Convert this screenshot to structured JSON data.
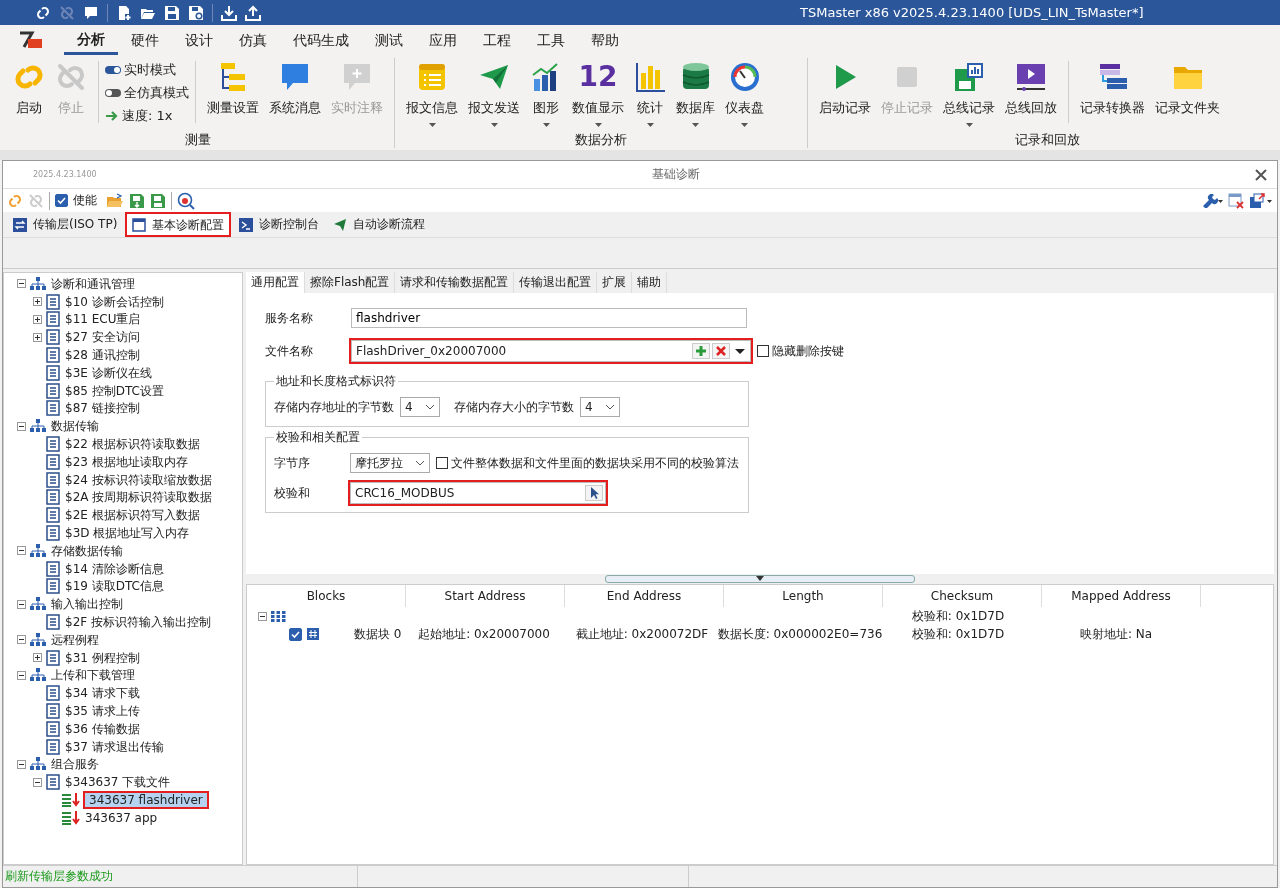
{
  "window": {
    "title": "TSMaster x86 v2025.4.23.1400 [UDS_LIN_TsMaster*]"
  },
  "menu": [
    {
      "label": "分析",
      "selected": true
    },
    {
      "label": "硬件",
      "selected": false
    },
    {
      "label": "设计",
      "selected": false
    },
    {
      "label": "仿真",
      "selected": false
    },
    {
      "label": "代码生成",
      "selected": false
    },
    {
      "label": "测试",
      "selected": false
    },
    {
      "label": "应用",
      "selected": false
    },
    {
      "label": "工程",
      "selected": false
    },
    {
      "label": "工具",
      "selected": false
    },
    {
      "label": "帮助",
      "selected": false
    }
  ],
  "ribbon": [
    {
      "label": "测量",
      "items": [
        {
          "kind": "large",
          "label": "启动",
          "disabled": false,
          "dropdown": false
        },
        {
          "kind": "large",
          "label": "停止",
          "disabled": true,
          "dropdown": false
        },
        {
          "kind": "separator"
        },
        {
          "kind": "stack",
          "rows": [
            {
              "kind": "toggle",
              "label": "实时模式",
              "on": true
            },
            {
              "kind": "toggle",
              "label": "全仿真模式",
              "on": false
            },
            {
              "kind": "speed",
              "label": "速度: 1x"
            }
          ]
        },
        {
          "kind": "separator"
        },
        {
          "kind": "large",
          "label": "测量设置",
          "disabled": false,
          "dropdown": false
        },
        {
          "kind": "large",
          "label": "系统消息",
          "disabled": false,
          "dropdown": false
        },
        {
          "kind": "large",
          "label": "实时注释",
          "disabled": true,
          "dropdown": false
        }
      ]
    },
    {
      "label": "数据分析",
      "items": [
        {
          "kind": "large",
          "label": "报文信息",
          "disabled": false,
          "dropdown": true
        },
        {
          "kind": "large",
          "label": "报文发送",
          "disabled": false,
          "dropdown": true
        },
        {
          "kind": "large",
          "label": "图形",
          "disabled": false,
          "dropdown": true
        },
        {
          "kind": "large",
          "label": "数值显示",
          "disabled": false,
          "dropdown": true,
          "glyph": "12"
        },
        {
          "kind": "large",
          "label": "统计",
          "disabled": false,
          "dropdown": true
        },
        {
          "kind": "large",
          "label": "数据库",
          "disabled": false,
          "dropdown": true
        },
        {
          "kind": "large",
          "label": "仪表盘",
          "disabled": false,
          "dropdown": true
        }
      ]
    },
    {
      "label": "记录和回放",
      "items": [
        {
          "kind": "large",
          "label": "启动记录",
          "disabled": false,
          "dropdown": false
        },
        {
          "kind": "large",
          "label": "停止记录",
          "disabled": true,
          "dropdown": false
        },
        {
          "kind": "large",
          "label": "总线记录",
          "disabled": false,
          "dropdown": true
        },
        {
          "kind": "large",
          "label": "总线回放",
          "disabled": false,
          "dropdown": false
        },
        {
          "kind": "separator"
        },
        {
          "kind": "large",
          "label": "记录转换器",
          "disabled": false,
          "dropdown": false
        },
        {
          "kind": "large",
          "label": "记录文件夹",
          "disabled": false,
          "dropdown": false
        }
      ]
    }
  ],
  "panel": {
    "version": "2025.4.23.1400",
    "title": "基础诊断",
    "enable": {
      "label": "使能",
      "checked": true
    },
    "tabs": [
      {
        "label": "传输层(ISO TP)",
        "selected": false,
        "highlighted": false
      },
      {
        "label": "基本诊断配置",
        "selected": true,
        "highlighted": true
      },
      {
        "label": "诊断控制台",
        "selected": false,
        "highlighted": false
      },
      {
        "label": "自动诊断流程",
        "selected": false,
        "highlighted": false
      }
    ]
  },
  "tree": [
    {
      "kind": "group",
      "label": "诊断和通讯管理",
      "expanded": true,
      "children": [
        {
          "kind": "service",
          "label": "$10 诊断会话控制",
          "expanded": false
        },
        {
          "kind": "service",
          "label": "$11 ECU重启",
          "expanded": false
        },
        {
          "kind": "service",
          "label": "$27 安全访问",
          "expanded": false
        },
        {
          "kind": "service",
          "label": "$28 通讯控制"
        },
        {
          "kind": "service",
          "label": "$3E 诊断仪在线"
        },
        {
          "kind": "service",
          "label": "$85 控制DTC设置"
        },
        {
          "kind": "service",
          "label": "$87 链接控制"
        }
      ]
    },
    {
      "kind": "group",
      "label": "数据传输",
      "expanded": true,
      "children": [
        {
          "kind": "service",
          "label": "$22 根据标识符读取数据"
        },
        {
          "kind": "service",
          "label": "$23 根据地址读取内存"
        },
        {
          "kind": "service",
          "label": "$24 按标识符读取缩放数据"
        },
        {
          "kind": "service",
          "label": "$2A 按周期标识符读取数据"
        },
        {
          "kind": "service",
          "label": "$2E 根据标识符写入数据"
        },
        {
          "kind": "service",
          "label": "$3D 根据地址写入内存"
        }
      ]
    },
    {
      "kind": "group",
      "label": "存储数据传输",
      "expanded": true,
      "children": [
        {
          "kind": "service",
          "label": "$14 清除诊断信息"
        },
        {
          "kind": "service",
          "label": "$19 读取DTC信息"
        }
      ]
    },
    {
      "kind": "group",
      "label": "输入输出控制",
      "expanded": true,
      "children": [
        {
          "kind": "service",
          "label": "$2F 按标识符输入输出控制"
        }
      ]
    },
    {
      "kind": "group",
      "label": "远程例程",
      "expanded": true,
      "children": [
        {
          "kind": "service",
          "label": "$31 例程控制",
          "expanded": false
        }
      ]
    },
    {
      "kind": "group",
      "label": "上传和下载管理",
      "expanded": true,
      "children": [
        {
          "kind": "service",
          "label": "$34 请求下载"
        },
        {
          "kind": "service",
          "label": "$35 请求上传"
        },
        {
          "kind": "service",
          "label": "$36 传输数据"
        },
        {
          "kind": "service",
          "label": "$37 请求退出传输"
        }
      ]
    },
    {
      "kind": "group",
      "label": "组合服务",
      "expanded": true,
      "children": [
        {
          "kind": "service",
          "label": "$343637 下载文件",
          "expanded": true,
          "children": [
            {
              "kind": "script",
              "label": "343637 flashdriver",
              "selected": true,
              "highlighted": true
            },
            {
              "kind": "script",
              "label": "343637 app",
              "selected": false,
              "highlighted": false
            }
          ]
        }
      ]
    }
  ],
  "subtabs": [
    {
      "label": "通用配置",
      "selected": true
    },
    {
      "label": "擦除Flash配置",
      "selected": false
    },
    {
      "label": "请求和传输数据配置",
      "selected": false
    },
    {
      "label": "传输退出配置",
      "selected": false
    },
    {
      "label": "扩展",
      "selected": false
    },
    {
      "label": "辅助",
      "selected": false
    }
  ],
  "form": {
    "service_name": {
      "label": "服务名称",
      "value": "flashdriver"
    },
    "file_name": {
      "label": "文件名称",
      "value": "FlashDriver_0x20007000",
      "highlighted": true,
      "hide_delete": {
        "label": "隐藏删除按键",
        "checked": false
      }
    },
    "address_format": {
      "title": "地址和长度格式标识符",
      "address_bytes": {
        "label": "存储内存地址的字节数",
        "value": "4"
      },
      "size_bytes": {
        "label": "存储内存大小的字节数",
        "value": "4"
      }
    },
    "checksum_config": {
      "title": "校验和相关配置",
      "byte_order": {
        "label": "字节序",
        "value": "摩托罗拉"
      },
      "separate_algorithm": {
        "label": "文件整体数据和文件里面的数据块采用不同的校验算法",
        "checked": false
      },
      "checksum": {
        "label": "校验和",
        "value": "CRC16_MODBUS",
        "highlighted": true
      }
    }
  },
  "blocks_table": {
    "columns": [
      "Blocks",
      "Start Address",
      "End Address",
      "Length",
      "Checksum",
      "Mapped Address"
    ],
    "root": {
      "expanded": true,
      "checksum": "校验和: 0x1D7D"
    },
    "rows": [
      {
        "checked": true,
        "cells": [
          "数据块 0",
          "起始地址: 0x20007000",
          "截止地址: 0x200072DF",
          "数据长度: 0x000002E0=736",
          "校验和: 0x1D7D",
          "映射地址: Na"
        ]
      }
    ]
  },
  "status_bar": "刷新传输层参数成功"
}
